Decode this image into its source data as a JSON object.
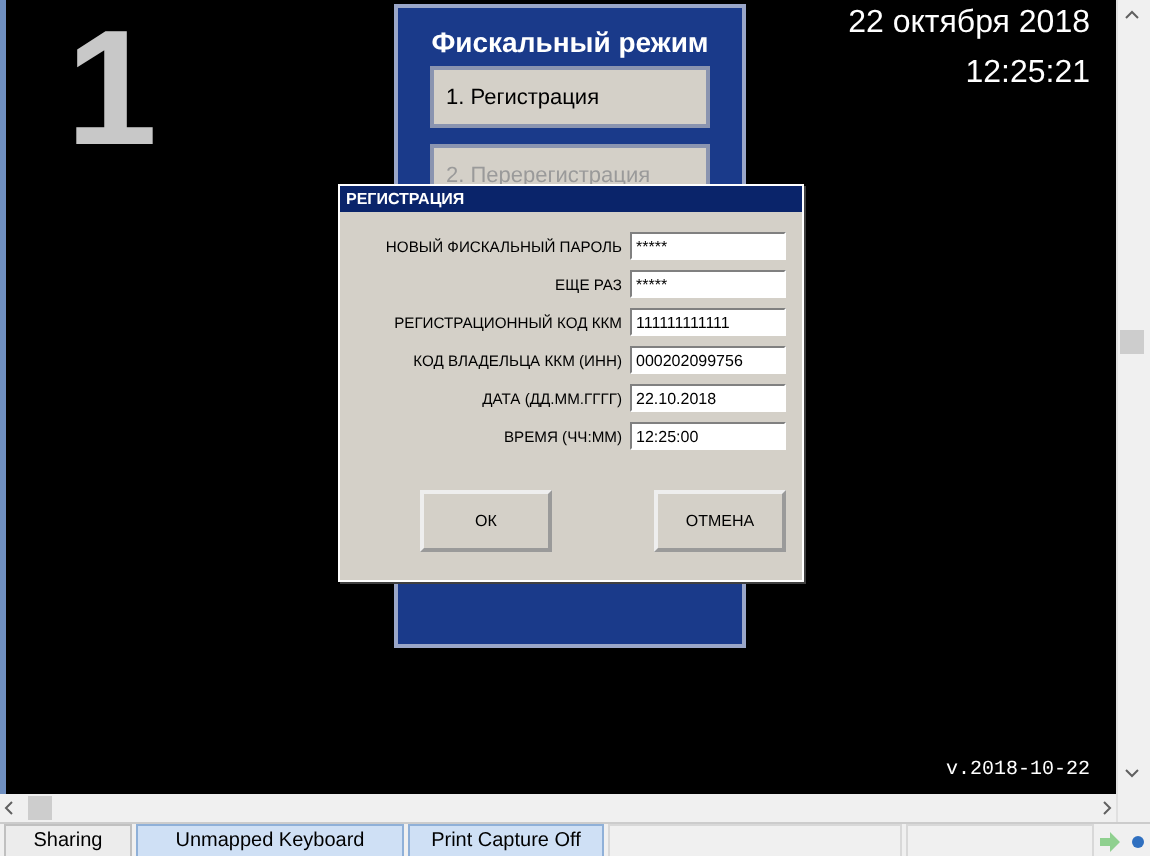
{
  "screen": {
    "number": "1",
    "date": "22 октября 2018",
    "time": "12:25:21",
    "version": "v.2018-10-22"
  },
  "menu": {
    "title": "Фискальный режим",
    "items": [
      {
        "label": "1. Регистрация",
        "disabled": false
      },
      {
        "label": "2. Перерегистрация",
        "disabled": true
      }
    ]
  },
  "dialog": {
    "title": "РЕГИСТРАЦИЯ",
    "fields": [
      {
        "label": "НОВЫЙ ФИСКАЛЬНЫЙ ПАРОЛЬ",
        "value": "*****"
      },
      {
        "label": "ЕЩЕ РАЗ",
        "value": "*****"
      },
      {
        "label": "РЕГИСТРАЦИОННЫЙ КОД ККМ",
        "value": "111111111111"
      },
      {
        "label": "КОД ВЛАДЕЛЬЦА ККМ (ИНН)",
        "value": "000202099756"
      },
      {
        "label": "ДАТА (ДД.ММ.ГГГГ)",
        "value": "22.10.2018"
      },
      {
        "label": "ВРЕМЯ (ЧЧ:ММ)",
        "value": "12:25:00"
      }
    ],
    "buttons": [
      "ОК",
      "ОТМЕНА"
    ]
  },
  "status_bar": [
    {
      "label": "Sharing",
      "active": false
    },
    {
      "label": "Unmapped Keyboard",
      "active": true
    },
    {
      "label": "Print Capture Off",
      "active": true
    }
  ]
}
